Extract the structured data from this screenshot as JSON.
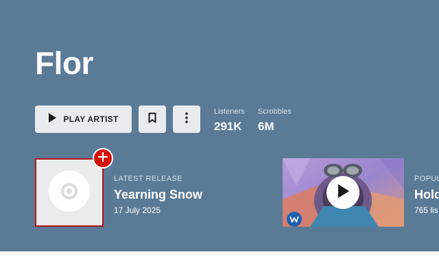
{
  "artist": {
    "name": "Flor"
  },
  "actions": {
    "play_label": "PLAY ARTIST"
  },
  "stats": {
    "listeners_label": "Listeners",
    "listeners_value": "291K",
    "scrobbles_label": "Scrobbles",
    "scrobbles_value": "6M"
  },
  "latest_release": {
    "eyebrow": "LATEST RELEASE",
    "title": "Yearning Snow",
    "date": "17 July 2025"
  },
  "popular": {
    "eyebrow": "POPUL",
    "title": "Hold",
    "meta": "765 lis"
  },
  "icons": {
    "play": "play-icon",
    "bookmark": "bookmark-icon",
    "more": "more-vertical-icon",
    "add": "plus-icon",
    "disc": "disc-icon",
    "label_logo": "record-label-logo"
  },
  "colors": {
    "hero_bg": "#5a7a96",
    "button_bg": "#e9ecef",
    "accent_red": "#d51007",
    "cover_border": "#b3131d"
  }
}
